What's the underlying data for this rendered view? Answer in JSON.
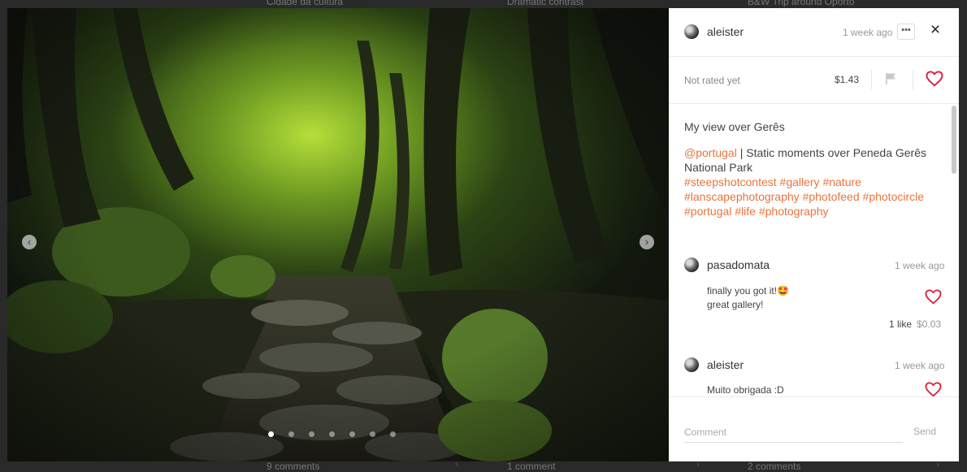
{
  "background": {
    "titles": [
      "Cidade da cultura",
      "Dramatic contrast",
      "B&W Trip around Oporto"
    ],
    "comments": [
      "9 comments",
      "1 comment",
      "2 comments"
    ]
  },
  "viewer": {
    "prev_icon": "chevron-left-icon",
    "next_icon": "chevron-right-icon",
    "slide_count": 7,
    "active_slide": 1
  },
  "post": {
    "author": "aleister",
    "time": "1 week ago",
    "more_label": "•••",
    "close_label": "×",
    "rating": "Not rated yet",
    "payout": "$1.43",
    "title": "My view over Gerês",
    "mention": "@portugal",
    "separator": "|",
    "description": "Static moments over Peneda Gerês National Park",
    "hashtags": [
      "#steepshotcontest",
      "#gallery",
      "#nature",
      "#lanscapephotography",
      "#photofeed",
      "#photocircle",
      "#portugal",
      "#life",
      "#photography"
    ]
  },
  "comments": [
    {
      "author": "pasadomata",
      "time": "1 week ago",
      "line1": "finally you got it!",
      "emoji": "🤩",
      "line2": "great gallery!",
      "likes": "1 like",
      "amount": "$0.03"
    },
    {
      "author": "aleister",
      "time": "1 week ago",
      "line1": "Muito obrigada :D"
    }
  ],
  "comment_box": {
    "placeholder": "Comment",
    "send_label": "Send"
  },
  "colors": {
    "accent": "#e8743b",
    "heart": "#d9263f",
    "panel_bg": "#ffffff"
  }
}
